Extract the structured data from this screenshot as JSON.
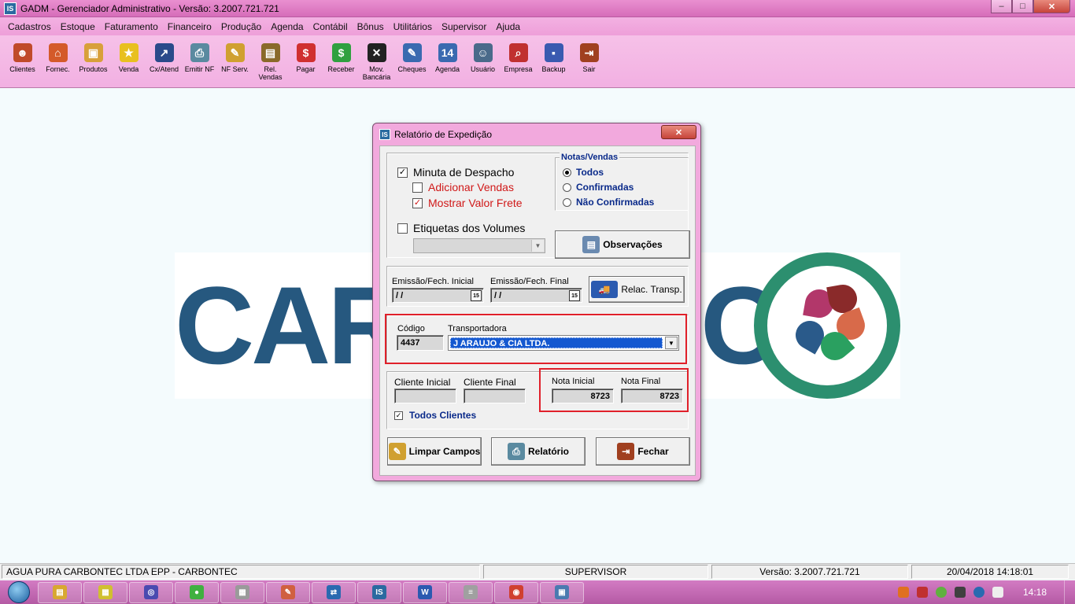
{
  "window": {
    "title": "GADM - Gerenciador Administrativo - Versão: 3.2007.721.721",
    "icon": "IS",
    "minimize": "–",
    "maximize": "□",
    "close": "✕"
  },
  "menu": [
    "Cadastros",
    "Estoque",
    "Faturamento",
    "Financeiro",
    "Produção",
    "Agenda",
    "Contábil",
    "Bônus",
    "Utilitários",
    "Supervisor",
    "Ajuda"
  ],
  "toolbar": [
    {
      "label": "Clientes",
      "icon": "person-icon",
      "color": "#c04a2a"
    },
    {
      "label": "Fornec.",
      "icon": "house-icon",
      "color": "#d45a2a"
    },
    {
      "label": "Produtos",
      "icon": "box-icon",
      "color": "#d8a03a"
    },
    {
      "label": "Venda",
      "icon": "star-icon",
      "color": "#e8c020"
    },
    {
      "label": "Cx/Atend",
      "icon": "chart-icon",
      "color": "#2a4a8a"
    },
    {
      "label": "Emitir NF",
      "icon": "printer-icon",
      "color": "#5a8aa0"
    },
    {
      "label": "NF Serv.",
      "icon": "pencil-doc-icon",
      "color": "#d0a030"
    },
    {
      "label": "Rel.\nVendas",
      "icon": "report-icon",
      "color": "#8a6a2a"
    },
    {
      "label": "Pagar",
      "icon": "pay-icon",
      "color": "#d03030"
    },
    {
      "label": "Receber",
      "icon": "receive-icon",
      "color": "#30a040"
    },
    {
      "label": "Mov.\nBancária",
      "icon": "bank-icon",
      "color": "#222222"
    },
    {
      "label": "Cheques",
      "icon": "cheque-icon",
      "color": "#3a6ab0"
    },
    {
      "label": "Agenda",
      "icon": "calendar-icon",
      "color": "#3a6ab0"
    },
    {
      "label": "Usuário",
      "icon": "users-icon",
      "color": "#4a6a8a"
    },
    {
      "label": "Empresa",
      "icon": "company-icon",
      "color": "#c03030"
    },
    {
      "label": "Backup",
      "icon": "disk-icon",
      "color": "#3a5ab0"
    },
    {
      "label": "Sair",
      "icon": "exit-icon",
      "color": "#a04020"
    }
  ],
  "logo": {
    "text_left": "CAR",
    "text_right": "C"
  },
  "dialog": {
    "title": "Relatório de Expedição",
    "close": "✕",
    "minuta": {
      "label": "Minuta de Despacho",
      "checked": true
    },
    "adicionar": {
      "label": "Adicionar Vendas",
      "checked": false
    },
    "mostrar": {
      "label": "Mostrar Valor Frete",
      "checked": true
    },
    "etiquetas": {
      "label": "Etiquetas dos Volumes",
      "checked": false
    },
    "notas": {
      "title": "Notas/Vendas",
      "options": [
        "Todos",
        "Confirmadas",
        "Não Confirmadas"
      ],
      "selected": 0
    },
    "observacoes": "Observações",
    "emissao_inicial": {
      "label": "Emissão/Fech. Inicial",
      "value": " /  /"
    },
    "emissao_final": {
      "label": "Emissão/Fech. Final",
      "value": " /  /"
    },
    "calendar_glyph": "15",
    "relac_transp": "Relac. Transp.",
    "codigo": {
      "label": "Código",
      "value": "4437"
    },
    "transportadora": {
      "label": "Transportadora",
      "value": "J ARAUJO & CIA LTDA."
    },
    "cliente_inicial": {
      "label": "Cliente Inicial",
      "value": ""
    },
    "cliente_final": {
      "label": "Cliente Final",
      "value": ""
    },
    "nota_inicial": {
      "label": "Nota Inicial",
      "value": "8723"
    },
    "nota_final": {
      "label": "Nota Final",
      "value": "8723"
    },
    "todos_clientes": {
      "label": "Todos Clientes",
      "checked": true
    },
    "buttons": {
      "limpar": "Limpar Campos",
      "relatorio": "Relatório",
      "fechar": "Fechar"
    }
  },
  "status": {
    "company": "AGUA PURA CARBONTEC LTDA EPP  -  CARBONTEC",
    "user": "SUPERVISOR",
    "version": "Versão: 3.2007.721.721",
    "datetime": "20/04/2018 14:18:01"
  },
  "taskbar": {
    "apps": [
      {
        "icon": "explorer-icon",
        "color": "#d8a830",
        "glyph": "▤"
      },
      {
        "icon": "files-icon",
        "color": "#d0c030",
        "glyph": "▦"
      },
      {
        "icon": "media-icon",
        "color": "#4a4ab0",
        "glyph": "◎"
      },
      {
        "icon": "green-app-icon",
        "color": "#40b040",
        "glyph": "●"
      },
      {
        "icon": "calculator-icon",
        "color": "#9a9a9a",
        "glyph": "▦"
      },
      {
        "icon": "paint-icon",
        "color": "#d06040",
        "glyph": "✎"
      },
      {
        "icon": "teamviewer-icon",
        "color": "#2a6ab0",
        "glyph": "⇄"
      },
      {
        "icon": "gadm-icon",
        "color": "#2a6aa0",
        "glyph": "IS"
      },
      {
        "icon": "word-icon",
        "color": "#2a5ab0",
        "glyph": "W"
      },
      {
        "icon": "notepad-icon",
        "color": "#a0a0a0",
        "glyph": "≡"
      },
      {
        "icon": "chrome-icon",
        "color": "#d04030",
        "glyph": "◉"
      },
      {
        "icon": "remote-icon",
        "color": "#4a7ab0",
        "glyph": "▣"
      }
    ],
    "clock": "14:18"
  }
}
